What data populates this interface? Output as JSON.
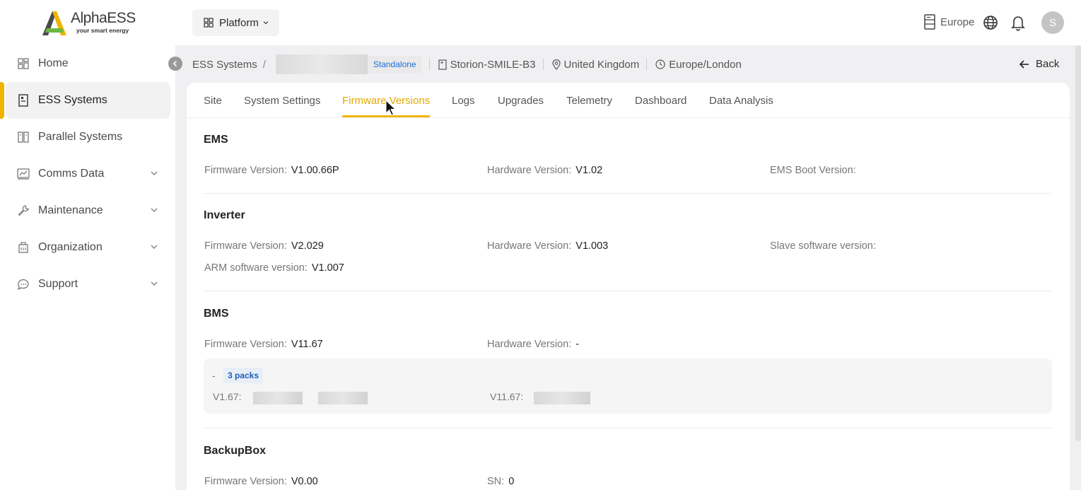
{
  "brand": {
    "name": "AlphaESS",
    "tagline": "your smart energy"
  },
  "sidebar": {
    "items": [
      {
        "label": "Home",
        "has_children": false
      },
      {
        "label": "ESS Systems",
        "has_children": false,
        "active": true
      },
      {
        "label": "Parallel Systems",
        "has_children": false
      },
      {
        "label": "Comms Data",
        "has_children": true
      },
      {
        "label": "Maintenance",
        "has_children": true
      },
      {
        "label": "Organization",
        "has_children": true
      },
      {
        "label": "Support",
        "has_children": true
      }
    ]
  },
  "header": {
    "platform_label": "Platform",
    "region_label": "Europe",
    "avatar_initial": "S"
  },
  "breadcrumb": {
    "root": "ESS Systems",
    "separator": "/",
    "badge": "Standalone",
    "model": "Storion-SMILE-B3",
    "country": "United Kingdom",
    "timezone": "Europe/London",
    "back_label": "Back"
  },
  "tabs": [
    "Site",
    "System Settings",
    "Firmware Versions",
    "Logs",
    "Upgrades",
    "Telemetry",
    "Dashboard",
    "Data Analysis"
  ],
  "active_tab": "Firmware Versions",
  "sections": {
    "ems": {
      "title": "EMS",
      "firmware_label": "Firmware Version",
      "firmware_value": "V1.00.66P",
      "hardware_label": "Hardware Version",
      "hardware_value": "V1.02",
      "boot_label": "EMS Boot Version"
    },
    "inverter": {
      "title": "Inverter",
      "firmware_label": "Firmware Version",
      "firmware_value": "V2.029",
      "hardware_label": "Hardware Version",
      "hardware_value": "V1.003",
      "slave_label": "Slave software version",
      "arm_label": "ARM software version",
      "arm_value": "V1.007"
    },
    "bms": {
      "title": "BMS",
      "firmware_label": "Firmware Version",
      "firmware_value": "V11.67",
      "hardware_label": "Hardware Version",
      "hardware_value": "-",
      "packs_toggle": "-",
      "packs_tag": "3 packs",
      "pack1_label": "V1.67",
      "pack2_label": "V11.67"
    },
    "backupbox": {
      "title": "BackupBox",
      "firmware_label": "Firmware Version",
      "firmware_value": "V0.00",
      "sn_label": "SN",
      "sn_value": "0"
    }
  },
  "colors": {
    "accent": "#f0b400",
    "link_blue": "#1d6fd8"
  }
}
